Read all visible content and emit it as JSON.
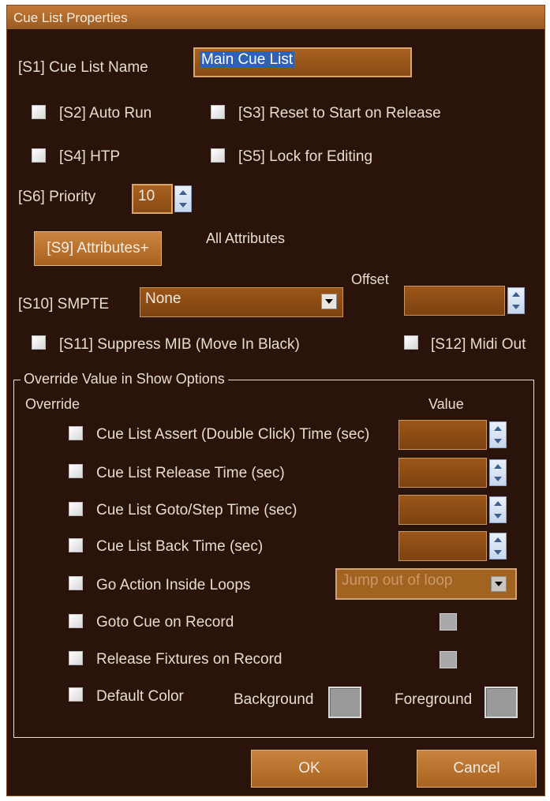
{
  "window": {
    "title": "Cue List Properties"
  },
  "s1": {
    "label": "[S1] Cue List Name",
    "value": "Main Cue List"
  },
  "s2": {
    "label": "[S2] Auto Run",
    "checked": false
  },
  "s3": {
    "label": "[S3] Reset to Start on Release",
    "checked": false
  },
  "s4": {
    "label": "[S4] HTP",
    "checked": false
  },
  "s5": {
    "label": "[S5] Lock for Editing",
    "checked": false
  },
  "s6": {
    "label": "[S6] Priority",
    "value": "10"
  },
  "s9": {
    "button_label": "[S9] Attributes+",
    "value_text": "All Attributes"
  },
  "s10": {
    "label": "[S10] SMPTE",
    "selected": "None",
    "offset_label": "Offset",
    "offset_value": ""
  },
  "s11": {
    "label": "[S11] Suppress MIB (Move In Black)",
    "checked": false
  },
  "s12": {
    "label": "[S12] Midi Out",
    "checked": false
  },
  "override_group": {
    "title": "Override Value in Show Options",
    "col_override": "Override",
    "col_value": "Value",
    "rows": [
      {
        "label": "Cue List Assert (Double Click) Time (sec)",
        "value": ""
      },
      {
        "label": "Cue List Release Time (sec)",
        "value": ""
      },
      {
        "label": "Cue List Goto/Step Time (sec)",
        "value": ""
      },
      {
        "label": "Cue List Back Time (sec)",
        "value": ""
      },
      {
        "label": "Go Action Inside Loops",
        "selected": "Jump out of loop"
      },
      {
        "label": "Goto Cue on Record"
      },
      {
        "label": "Release Fixtures on Record"
      },
      {
        "label": "Default Color",
        "background_label": "Background",
        "foreground_label": "Foreground"
      }
    ]
  },
  "buttons": {
    "ok": "OK",
    "cancel": "Cancel"
  },
  "colors": {
    "background": "#2a130b",
    "accent": "#a8611f",
    "title_bar": "#b06a2b"
  }
}
